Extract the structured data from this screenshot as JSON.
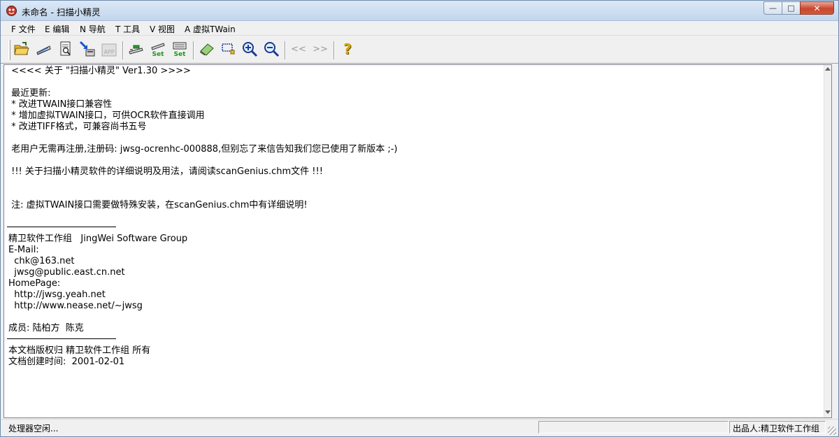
{
  "window": {
    "title": "未命名 - 扫描小精灵",
    "controls": {
      "minimize": "—",
      "maximize": "□",
      "close": "✕"
    }
  },
  "menu": [
    "F 文件",
    "E 编辑",
    "N 导航",
    "T 工具",
    "V 视图",
    "A 虚拟TWain"
  ],
  "toolbar": {
    "buttons": [
      {
        "name": "open-folder",
        "icon": "folder-open-icon"
      },
      {
        "name": "scanner",
        "icon": "scanner-icon"
      },
      {
        "name": "page-preview",
        "icon": "document-preview-icon"
      },
      {
        "name": "scan-to-app",
        "icon": "import-arrow-icon"
      },
      {
        "name": "app-disabled",
        "icon": "app-icon",
        "label": "APP"
      },
      {
        "name": "batch-scan",
        "icon": "batch-scan-icon"
      },
      {
        "name": "scanner-set",
        "icon": "scanner-settings-icon",
        "label": "Set"
      },
      {
        "name": "keyboard-set",
        "icon": "keyboard-settings-icon",
        "label": "Set"
      },
      {
        "name": "eraser",
        "icon": "eraser-icon"
      },
      {
        "name": "select-rect",
        "icon": "select-rectangle-icon"
      },
      {
        "name": "zoom-in",
        "icon": "zoom-in-icon"
      },
      {
        "name": "zoom-out",
        "icon": "zoom-out-icon"
      },
      {
        "name": "prev-page",
        "icon": "double-left-icon",
        "label": "<<"
      },
      {
        "name": "next-page",
        "icon": "double-right-icon",
        "label": ">>"
      },
      {
        "name": "help",
        "icon": "question-icon",
        "label": "?"
      }
    ]
  },
  "document": {
    "lines": [
      " <<<< 关于 \"扫描小精灵\" Ver1.30 >>>>",
      "",
      " 最近更新:",
      " * 改进TWAIN接口兼容性",
      " * 增加虚拟TWAIN接口，可供OCR软件直接调用",
      " * 改进TIFF格式，可兼容尚书五号",
      "",
      " 老用户无需再注册,注册码: jwsg-ocrenhc-000888,但别忘了来信告知我们您已使用了新版本 ;-)",
      "",
      " !!! 关于扫描小精灵软件的详细说明及用法，请阅读scanGenius.chm文件 !!!",
      "",
      "",
      " 注: 虚拟TWAIN接口需要做特殊安装，在scanGenius.chm中有详细说明!",
      "",
      "",
      "精卫软件工作组   JingWei Software Group",
      "E-Mail:",
      "  chk@163.net",
      "  jwsg@public.east.cn.net",
      "HomePage:",
      "  http://jwsg.yeah.net",
      "  http://www.nease.net/~jwsg",
      "",
      "成员: 陆柏方  陈克",
      "",
      "本文档版权归 精卫软件工作组 所有",
      "文档创建时间:  2001-02-01"
    ]
  },
  "status": {
    "left": "处理器空闲...",
    "middle": "",
    "right": "出品人:精卫软件工作组"
  }
}
